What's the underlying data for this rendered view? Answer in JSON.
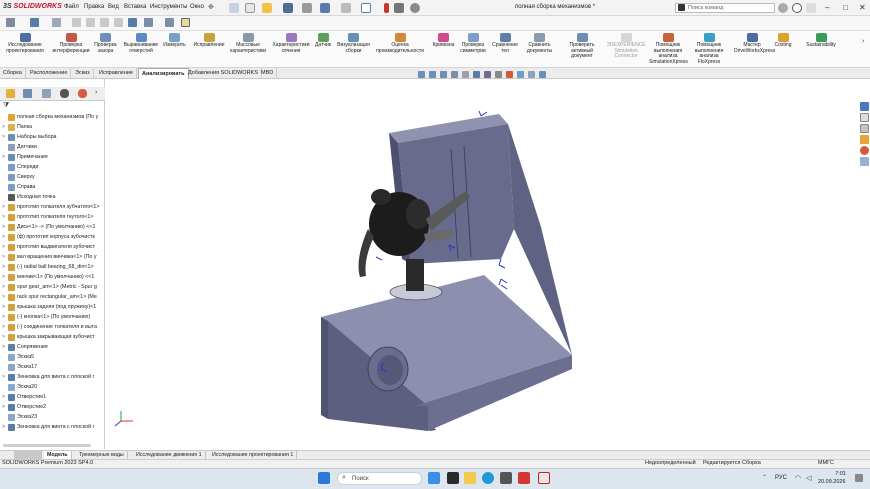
{
  "titlebar": {
    "logo_brand": "3S",
    "logo_text": "SOLIDWORKS",
    "menu": [
      "Файл",
      "Правка",
      "Вид",
      "Вставка",
      "Инструменты",
      "Окно"
    ],
    "doc_title": "полная сборка механизмов *",
    "search_placeholder": "Поиск команд",
    "window_controls": [
      "–",
      "□",
      "✕"
    ]
  },
  "ribbon": {
    "buttons": [
      {
        "label": "Исследование проектирования",
        "enabled": true
      },
      {
        "label": "Проверка интерференции",
        "enabled": true
      },
      {
        "label": "Проверка зазора",
        "enabled": true
      },
      {
        "label": "Выравнивание отверстий",
        "enabled": true
      },
      {
        "label": "Измерить",
        "enabled": true
      },
      {
        "label": "Исправление",
        "enabled": true
      },
      {
        "label": "Массовые характеристики",
        "enabled": true
      },
      {
        "label": "Характеристики сечения",
        "enabled": true
      },
      {
        "label": "Датчик",
        "enabled": true
      },
      {
        "label": "Визуализация сборки",
        "enabled": true
      },
      {
        "label": "Оценка производительности",
        "enabled": true
      },
      {
        "label": "Кривизна",
        "enabled": true
      },
      {
        "label": "Проверка симметрии",
        "enabled": true
      },
      {
        "label": "Сравнение тел",
        "enabled": true
      },
      {
        "label": "Сравнить документы",
        "enabled": true
      },
      {
        "label": "Проверить активный документ",
        "enabled": true
      },
      {
        "label": "3DEXPERIENCE Simulation Connector",
        "enabled": false
      },
      {
        "label": "Помощник выполнения анализа SimulationXpress",
        "enabled": true
      },
      {
        "label": "Помощник выполнения анализа FloXpress",
        "enabled": true
      },
      {
        "label": "Мастер DriveWorksXpress",
        "enabled": true
      },
      {
        "label": "Costing",
        "enabled": true
      },
      {
        "label": "Sustainability",
        "enabled": true
      }
    ]
  },
  "tabs": [
    "Сборка",
    "Расположение",
    "Эскиз",
    "Исправление",
    "Анализировать",
    "Добавления SOLIDWORKS",
    "MBD"
  ],
  "active_tab": "Анализировать",
  "tree": {
    "items": [
      {
        "label": "полная сборка механизмов (По у",
        "color": "#e0a52a",
        "arrow": ""
      },
      {
        "label": "Папка",
        "color": "#d9b24a",
        "arrow": ">"
      },
      {
        "label": "Наборы выбора",
        "color": "#6d8fb5",
        "arrow": ">"
      },
      {
        "label": "Датчики",
        "color": "#8aa0b8",
        "arrow": ""
      },
      {
        "label": "Примечания",
        "color": "#6a8fb0",
        "arrow": ">"
      },
      {
        "label": "Спереди",
        "color": "#7b9bc2",
        "arrow": ""
      },
      {
        "label": "Сверху",
        "color": "#7b9bc2",
        "arrow": ""
      },
      {
        "label": "Справа",
        "color": "#7b9bc2",
        "arrow": ""
      },
      {
        "label": "Исходная точка",
        "color": "#555555",
        "arrow": ""
      },
      {
        "label": "прототип толкателя зубчатого<1>",
        "color": "#d4a23a",
        "arrow": ">"
      },
      {
        "label": "прототип толкателя гнутого<1>",
        "color": "#d4a23a",
        "arrow": ">"
      },
      {
        "label": "Диск<1> -> (По умолчанию) <<1",
        "color": "#d4a23a",
        "arrow": ">"
      },
      {
        "label": "(ф) прототип корпуса зубочистк",
        "color": "#d4a23a",
        "arrow": ">"
      },
      {
        "label": "прототип выдвигателя зубочист",
        "color": "#d4a23a",
        "arrow": ">"
      },
      {
        "label": "вал вращения винчика<1> (По у",
        "color": "#d4a23a",
        "arrow": ">"
      },
      {
        "label": "(-) radial ball bearing_68_din<1>",
        "color": "#d4a23a",
        "arrow": ">"
      },
      {
        "label": "винчик<1> (По умолчанию) <<1",
        "color": "#d4a23a",
        "arrow": ">"
      },
      {
        "label": "spur gear_am<1> (Metric - Spur g",
        "color": "#d4a23a",
        "arrow": ">"
      },
      {
        "label": "rack spur rectangular_am<1> (Me",
        "color": "#d4a23a",
        "arrow": ">"
      },
      {
        "label": "крышка задняя (под пружину)<1",
        "color": "#d4a23a",
        "arrow": ">"
      },
      {
        "label": "(-) кнопка<1> (По умолчанию)",
        "color": "#d4a23a",
        "arrow": ">"
      },
      {
        "label": "(-) соединение толкателя и выта",
        "color": "#d4a23a",
        "arrow": ">"
      },
      {
        "label": "крышка закрывающая зубочист",
        "color": "#d4a23a",
        "arrow": ">"
      },
      {
        "label": "Сопряжения",
        "color": "#5f7fa5",
        "arrow": ">"
      },
      {
        "label": "Эскиз5",
        "color": "#8aa6c8",
        "arrow": ""
      },
      {
        "label": "Эскиз17",
        "color": "#8aa6c8",
        "arrow": ""
      },
      {
        "label": "Зенковка для  винта с плоской г",
        "color": "#5a7da8",
        "arrow": ">"
      },
      {
        "label": "Эскиз20",
        "color": "#8aa6c8",
        "arrow": ""
      },
      {
        "label": "Отверстие1",
        "color": "#5a7da8",
        "arrow": ">"
      },
      {
        "label": "Отверстие2",
        "color": "#5a7da8",
        "arrow": ">"
      },
      {
        "label": "Эскиз23",
        "color": "#8aa6c8",
        "arrow": ""
      },
      {
        "label": "Зенковка для  винта с плоской г",
        "color": "#5a7da8",
        "arrow": ">"
      }
    ]
  },
  "bottom_tabs": [
    "Модель",
    "Трехмерные виды",
    "Исследование движения 1",
    "Исследование проектирования 1"
  ],
  "bottom_first_tab": "",
  "active_bottom_tab": "Модель",
  "status": {
    "left": "SOLIDWORKS Premium 2023 SP4.0",
    "state": "Недоопределенный",
    "editing": "Редактируется Сборка",
    "units": "ММГС"
  },
  "taskbar": {
    "search_placeholder": "Поиск",
    "lang": "РУС",
    "time": "7:01",
    "date": "20.09.2026"
  },
  "colors": {
    "box_face_front": "#5b5e7a",
    "box_face_top": "#8a8cab",
    "box_face_side": "#6f7292",
    "accent_red": "#c8102e"
  }
}
